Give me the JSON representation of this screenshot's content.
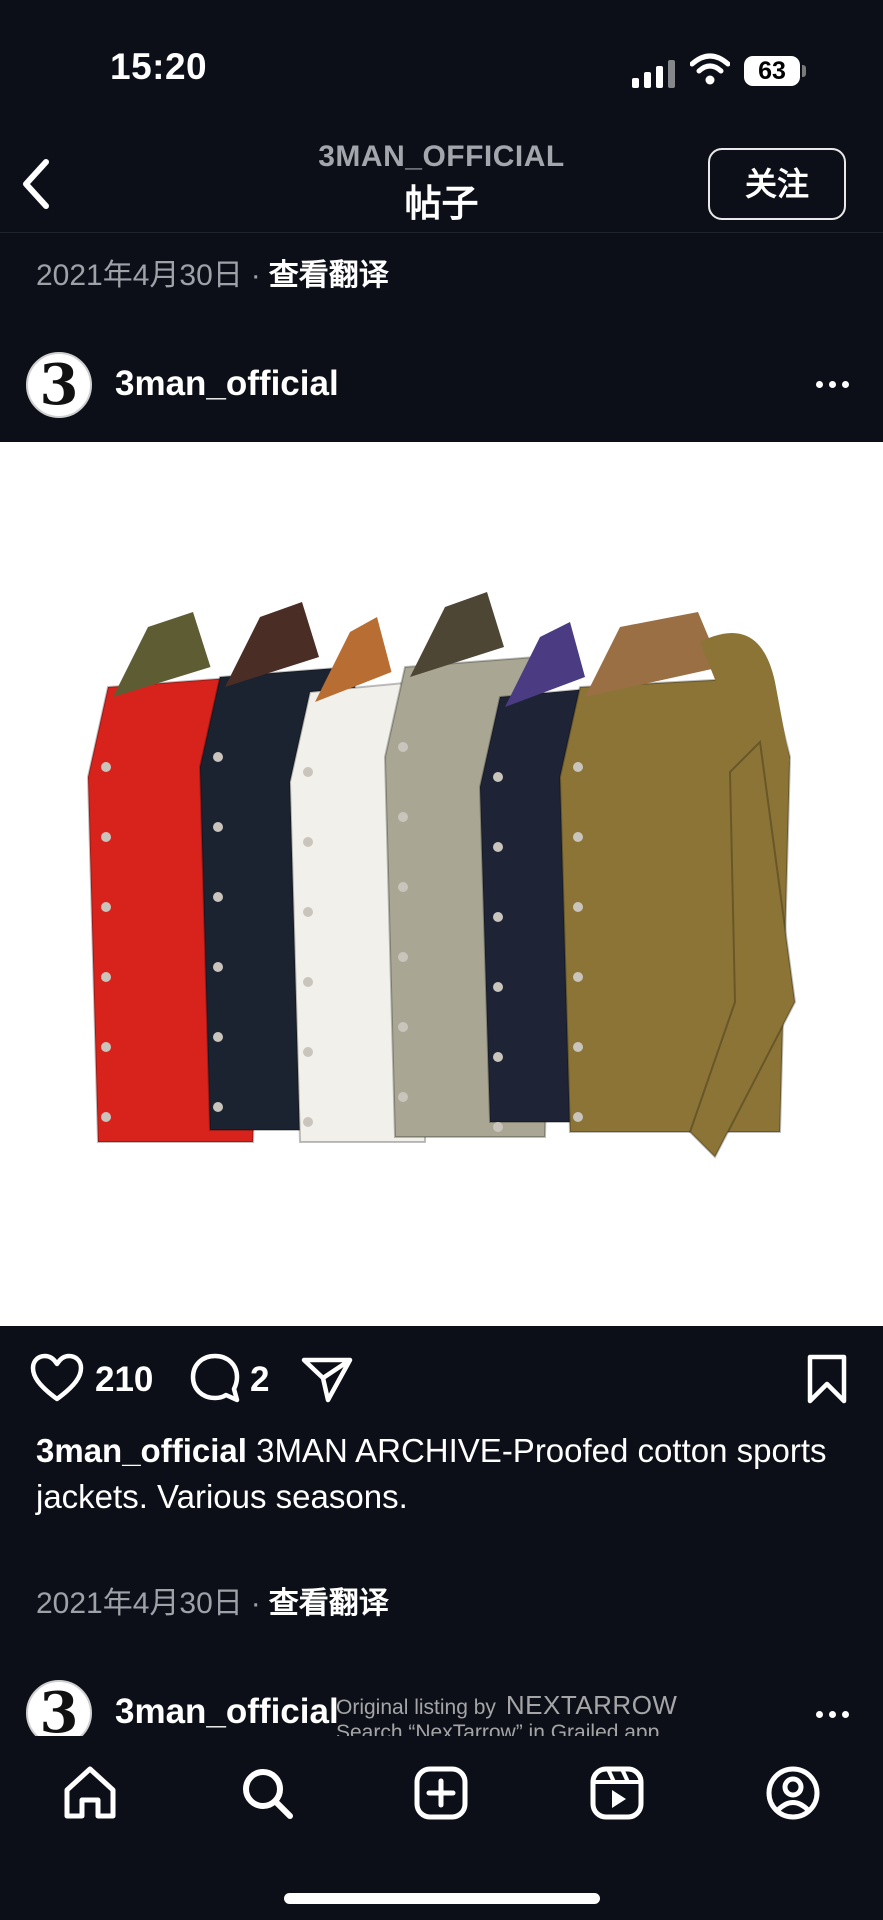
{
  "status_bar": {
    "time": "15:20",
    "battery": "63"
  },
  "header": {
    "username": "3MAN_OFFICIAL",
    "title": "帖子",
    "follow_label": "关注"
  },
  "top_meta": {
    "date": "2021年4月30日",
    "separator": "·",
    "translate_label": "查看翻译"
  },
  "post": {
    "avatar_text": "3",
    "username": "3man_official",
    "image_subject": "six jackets",
    "likes": "210",
    "comments": "2",
    "caption_user": "3man_official",
    "caption_text": "3MAN ARCHIVE-Proofed cotton sports jackets. Various seasons.",
    "date": "2021年4月30日",
    "separator": "·",
    "translate_label": "查看翻译"
  },
  "next_post": {
    "avatar_text": "3",
    "username": "3man_official"
  },
  "watermark": {
    "line1": "Original listing by",
    "brand": "NEXTARROW",
    "line2": "Search “NexTarrow” in Grailed app."
  },
  "jacket_colors": [
    "#d8231c",
    "#1b2230",
    "#f2f0ea",
    "#a9a793",
    "#1e2436",
    "#8b7436"
  ],
  "collar_colors": [
    "#5e5c33",
    "#4a2e26",
    "#b86e33",
    "#4d4634",
    "#4b3b83",
    "#9a6f43"
  ],
  "nav": [
    "home-icon",
    "search-icon",
    "create-icon",
    "reels-icon",
    "profile-icon"
  ]
}
